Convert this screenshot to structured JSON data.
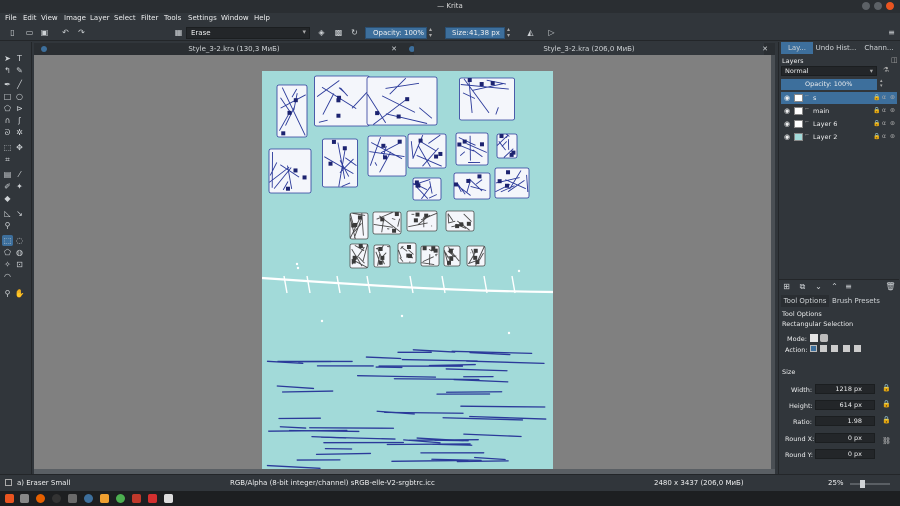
{
  "window": {
    "title": "— Krita"
  },
  "menu": [
    "File",
    "Edit",
    "View",
    "Image",
    "Layer",
    "Select",
    "Filter",
    "Tools",
    "Settings",
    "Window",
    "Help"
  ],
  "toolbar": {
    "preset_name": "Erase",
    "opacity_label": "Opacity: 100%",
    "size_label": "Size:",
    "size_value": "41,38 px"
  },
  "documents": {
    "tab1": "Style_3-2.kra (130,3 МиБ)",
    "tab2": "Style_3-2.kra (206,0 МиБ)"
  },
  "dock": {
    "tabs": [
      "Lay...",
      "Undo Hist...",
      "Chann..."
    ],
    "layers_title": "Layers",
    "blend_mode": "Normal",
    "opacity": "Opacity:  100%",
    "layers": [
      {
        "name": "s",
        "selected": true,
        "thumb": "#ffffff"
      },
      {
        "name": "main",
        "selected": false,
        "thumb": "#ffffff"
      },
      {
        "name": "Layer 6",
        "selected": false,
        "thumb": "#ffffff"
      },
      {
        "name": "Layer 2",
        "selected": false,
        "thumb": "#a2dad9"
      }
    ],
    "options_tabs": [
      "Tool Options",
      "Brush Presets"
    ],
    "tool_options_title": "Tool Options",
    "tool_name": "Rectangular Selection",
    "mode_label": "Mode:",
    "action_label": "Action:",
    "size_section": "Size",
    "width_label": "Width:",
    "width_value": "1218 px",
    "height_label": "Height:",
    "height_value": "614 px",
    "ratio_label": "Ratio:",
    "ratio_value": "1.98",
    "roundx_label": "Round X:",
    "roundx_value": "0 px",
    "roundy_label": "Round Y:",
    "roundy_value": "0 px"
  },
  "status": {
    "brush": "a) Eraser Small",
    "colorspace": "RGB/Alpha (8-bit integer/channel)  sRGB-elle-V2-srgbtrc.icc",
    "image_size": "2480 x 3437 (206,0 МиБ)",
    "zoom": "25%"
  },
  "colors": {
    "accent": "#3d6f9c",
    "paper": "#a2dad9",
    "ink": "#2b3a9a"
  }
}
